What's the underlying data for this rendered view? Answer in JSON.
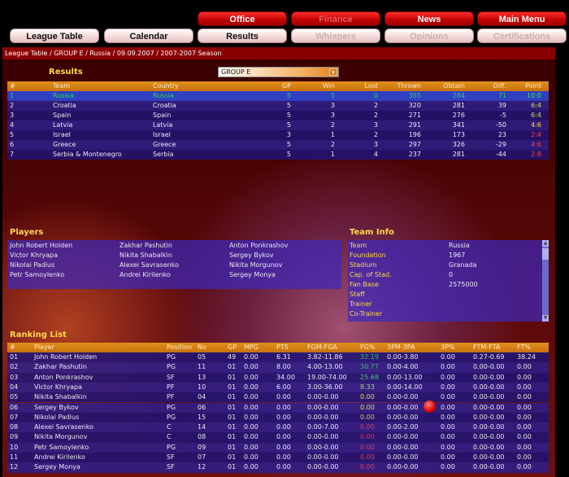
{
  "nav": {
    "top": [
      {
        "label": "Office",
        "enabled": true
      },
      {
        "label": "Finance",
        "enabled": false
      },
      {
        "label": "News",
        "enabled": true
      },
      {
        "label": "Main Menu",
        "enabled": true
      }
    ],
    "bottom": [
      {
        "label": "League Table",
        "enabled": true
      },
      {
        "label": "Calendar",
        "enabled": true
      },
      {
        "label": "Results",
        "enabled": true
      },
      {
        "label": "Whispers",
        "enabled": false
      },
      {
        "label": "Opinions",
        "enabled": false
      },
      {
        "label": "Certifications",
        "enabled": false
      }
    ]
  },
  "breadcrumb": "League Table / GROUP E / Russia / 09.09.2007 / 2007-2007 Season",
  "results": {
    "title": "Results",
    "group_select": "GROUP E",
    "columns": [
      "#",
      "Team",
      "Country",
      "GP",
      "Win",
      "Lost",
      "Thrown",
      "Obtain",
      "Diff.",
      "Point"
    ],
    "rows": [
      [
        "1",
        "Russia",
        "Russia",
        "5",
        "5",
        "0",
        "355",
        "284",
        "71",
        "10:0"
      ],
      [
        "2",
        "Croatia",
        "Croatia",
        "5",
        "3",
        "2",
        "320",
        "281",
        "39",
        "6:4"
      ],
      [
        "3",
        "Spain",
        "Spain",
        "5",
        "3",
        "2",
        "271",
        "276",
        "-5",
        "6:4"
      ],
      [
        "4",
        "Latvia",
        "Latvia",
        "5",
        "2",
        "3",
        "291",
        "341",
        "-50",
        "4:6"
      ],
      [
        "5",
        "Israel",
        "Israel",
        "3",
        "1",
        "2",
        "196",
        "173",
        "23",
        "2:4"
      ],
      [
        "6",
        "Greece",
        "Greece",
        "5",
        "2",
        "3",
        "297",
        "326",
        "-29",
        "4:6"
      ],
      [
        "7",
        "Serbia & Montenegro",
        "Serbia",
        "5",
        "1",
        "4",
        "237",
        "281",
        "-44",
        "2:8"
      ]
    ],
    "point_colors": [
      "#40e060",
      "#c0e060",
      "#c0e060",
      "#ffd84a",
      "#ff4040",
      "#ff4040",
      "#ff4040"
    ],
    "selected_color": "#30d060"
  },
  "players": {
    "title": "Players",
    "names": [
      "John Robert Holden",
      "Zakhar Pashutin",
      "Anton Ponkrashov",
      "Victor Khryapa",
      "Nikita Shabalkin",
      "Sergey Bykov",
      "Nikolai Padius",
      "Alexei Savrasenko",
      "Nikita Morgunov",
      "Petr Samoylenko",
      "Andrei Kirilenko",
      "Sergey Monya"
    ]
  },
  "team_info": {
    "title": "Team Info",
    "rows": [
      [
        "Team",
        "Russia"
      ],
      [
        "Foundation",
        "1967"
      ],
      [
        "Stadium",
        "Granada"
      ],
      [
        "Cap. of Stad.",
        "0"
      ],
      [
        "Fan Base",
        "2575000"
      ],
      [
        "Staff",
        ""
      ],
      [
        "Trainer",
        ""
      ],
      [
        "Co-Trainer",
        ""
      ]
    ]
  },
  "ranking": {
    "title": "Ranking List",
    "columns": [
      "#",
      "Player",
      "Position",
      "No",
      "GP",
      "MPG",
      "PTS",
      "FGM-FGA",
      "FG%",
      "3PM-3PA",
      "3P%",
      "FTM-FTA",
      "FT%"
    ],
    "rows": [
      [
        "01",
        "John Robert Holden",
        "PG",
        "05",
        "49",
        "0.00",
        "6.31",
        "3.82-11.86",
        "32.19",
        "0.00-3.80",
        "0.00",
        "0.27-0.69",
        "38.24"
      ],
      [
        "02",
        "Zakhar Pashutin",
        "PG",
        "11",
        "01",
        "0.00",
        "8.00",
        "4.00-13.00",
        "30.77",
        "0.00-4.00",
        "0.00",
        "0.00-0.00",
        "0.00"
      ],
      [
        "03",
        "Anton Ponkrashov",
        "SF",
        "13",
        "01",
        "0.00",
        "34.00",
        "19.00-74.00",
        "25.68",
        "0.00-13.00",
        "0.00",
        "0.00-0.00",
        "0.00"
      ],
      [
        "04",
        "Victor Khryapa",
        "PF",
        "10",
        "01",
        "0.00",
        "6.00",
        "3.00-36.00",
        "8.33",
        "0.00-14.00",
        "0.00",
        "0.00-0.00",
        "0.00"
      ],
      [
        "05",
        "Nikita Shabalkin",
        "PF",
        "04",
        "01",
        "0.00",
        "0.00",
        "0.00-0.00",
        "0.00",
        "0.00-0.00",
        "0.00",
        "0.00-0.00",
        "0.00"
      ],
      [
        "06",
        "Sergey Bykov",
        "PG",
        "06",
        "01",
        "0.00",
        "0.00",
        "0.00-0.00",
        "0.00",
        "0.00-0.00",
        "0.00",
        "0.00-0.00",
        "0.00"
      ],
      [
        "07",
        "Nikolai Padius",
        "PG",
        "15",
        "01",
        "0.00",
        "0.00",
        "0.00-0.00",
        "0.00",
        "0.00-0.00",
        "0.00",
        "0.00-0.00",
        "0.00"
      ],
      [
        "08",
        "Alexei Savrasenko",
        "C",
        "14",
        "01",
        "0.00",
        "0.00",
        "0.00-7.00",
        "0.00",
        "0.00-2.00",
        "0.00",
        "0.00-0.00",
        "0.00"
      ],
      [
        "09",
        "Nikita Morgunov",
        "C",
        "08",
        "01",
        "0.00",
        "0.00",
        "0.00-0.00",
        "0.00",
        "0.00-0.00",
        "0.00",
        "0.00-0.00",
        "0.00"
      ],
      [
        "10",
        "Petr Samoylenko",
        "PG",
        "09",
        "01",
        "0.00",
        "0.00",
        "0.00-0.00",
        "0.00",
        "0.00-0.00",
        "0.00",
        "0.00-0.00",
        "0.00"
      ],
      [
        "11",
        "Andrei Kirilenko",
        "SF",
        "07",
        "01",
        "0.00",
        "0.00",
        "0.00-0.00",
        "0.00",
        "0.00-0.00",
        "0.00",
        "0.00-0.00",
        "0.00"
      ],
      [
        "12",
        "Sergey Monya",
        "SF",
        "12",
        "01",
        "0.00",
        "0.00",
        "0.00-0.00",
        "0.00",
        "0.00-0.00",
        "0.00",
        "0.00-0.00",
        "0.00"
      ]
    ],
    "fg_colors": [
      "#30c060",
      "#30c060",
      "#40d060",
      "#90e060",
      "#e0e040",
      "#e0e040",
      "#e0c040",
      "#ff3040",
      "#ff3040",
      "#ff3040",
      "#ff3040",
      "#ff3040"
    ]
  }
}
